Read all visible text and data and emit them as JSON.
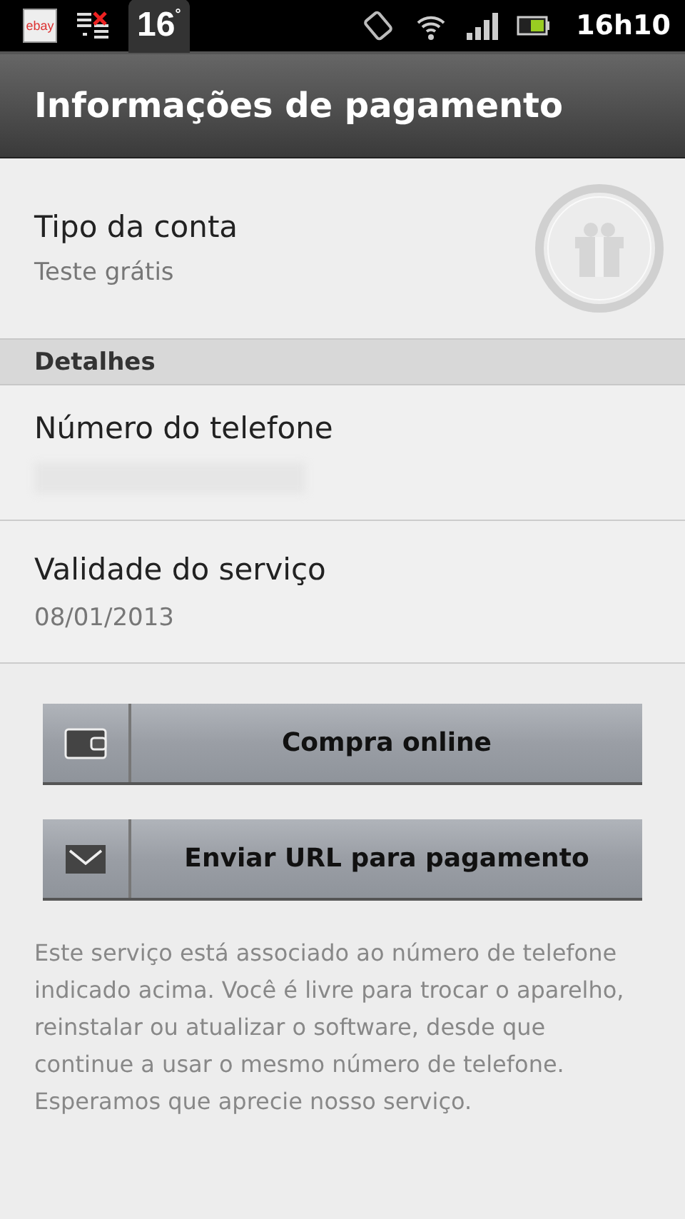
{
  "status_bar": {
    "notification_app": "ebay",
    "temperature": "16",
    "degree": "°",
    "time": "16h10"
  },
  "title": "Informações de pagamento",
  "account": {
    "label": "Tipo da conta",
    "value": "Teste grátis"
  },
  "section_header": "Detalhes",
  "details": [
    {
      "label": "Número do telefone",
      "kind": "hidden"
    },
    {
      "label": "Validade do serviço",
      "value": "08/01/2013",
      "kind": "text"
    }
  ],
  "buttons": [
    {
      "label": "Compra online",
      "kind": "wallet"
    },
    {
      "label": "Enviar URL para pagamento",
      "kind": "mail"
    }
  ],
  "note": "Este serviço está associado ao número de telefone indicado acima. Você é livre para trocar o aparelho, reinstalar ou atualizar o software, desde que continue a usar o mesmo número de telefone. Esperamos que aprecie nosso serviço."
}
